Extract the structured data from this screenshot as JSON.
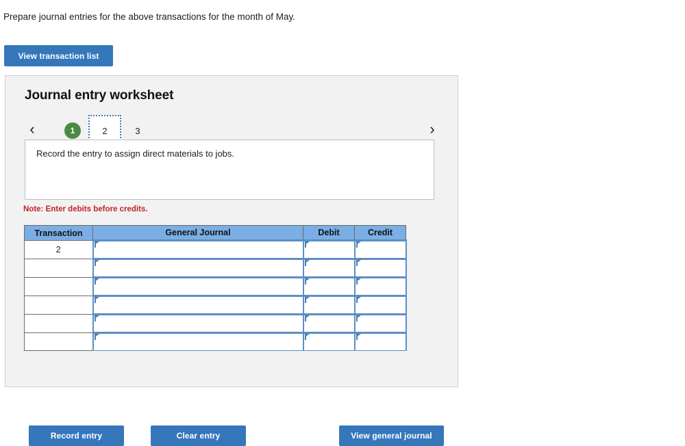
{
  "prompt": "Prepare journal entries for the above transactions for the month of May.",
  "toolbar": {
    "view_transaction_list_label": "View transaction list"
  },
  "worksheet": {
    "title": "Journal entry worksheet",
    "pager": {
      "prev_icon": "‹",
      "next_icon": "›",
      "tabs": [
        {
          "label": "1",
          "state": "completed"
        },
        {
          "label": "2",
          "state": "active"
        },
        {
          "label": "3",
          "state": "pending"
        }
      ]
    },
    "instruction": "Record the entry to assign direct materials to jobs.",
    "note": "Note: Enter debits before credits.",
    "table": {
      "headers": [
        "Transaction",
        "General Journal",
        "Debit",
        "Credit"
      ],
      "rows": [
        {
          "transaction": "2",
          "general_journal": "",
          "debit": "",
          "credit": ""
        },
        {
          "transaction": "",
          "general_journal": "",
          "debit": "",
          "credit": ""
        },
        {
          "transaction": "",
          "general_journal": "",
          "debit": "",
          "credit": ""
        },
        {
          "transaction": "",
          "general_journal": "",
          "debit": "",
          "credit": ""
        },
        {
          "transaction": "",
          "general_journal": "",
          "debit": "",
          "credit": ""
        },
        {
          "transaction": "",
          "general_journal": "",
          "debit": "",
          "credit": ""
        }
      ]
    },
    "actions": {
      "record_entry_label": "Record entry",
      "clear_entry_label": "Clear entry",
      "view_general_journal_label": "View general journal"
    }
  },
  "colors": {
    "button_blue": "#3677bc",
    "header_blue": "#7aaee4",
    "badge_green": "#4a8a42",
    "note_red": "#c0232b",
    "panel_gray": "#f2f2f2",
    "input_border_blue": "#5a8fc4"
  }
}
